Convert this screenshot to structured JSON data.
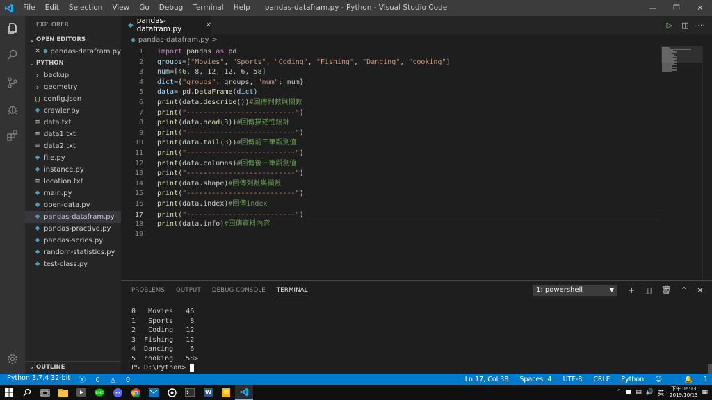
{
  "window": {
    "title": "pandas-datafram.py - Python - Visual Studio Code",
    "menu": [
      "File",
      "Edit",
      "Selection",
      "View",
      "Go",
      "Debug",
      "Terminal",
      "Help"
    ]
  },
  "sidebar": {
    "header": "EXPLORER",
    "open_editors_label": "OPEN EDITORS",
    "open_editors": [
      {
        "name": "pandas-datafram.py"
      }
    ],
    "folder_label": "PYTHON",
    "items": [
      {
        "name": "backup",
        "type": "folder"
      },
      {
        "name": "geometry",
        "type": "folder"
      },
      {
        "name": "config.json",
        "type": "json"
      },
      {
        "name": "crawler.py",
        "type": "py"
      },
      {
        "name": "data.txt",
        "type": "txt"
      },
      {
        "name": "data1.txt",
        "type": "txt"
      },
      {
        "name": "data2.txt",
        "type": "txt"
      },
      {
        "name": "file.py",
        "type": "py"
      },
      {
        "name": "instance.py",
        "type": "py"
      },
      {
        "name": "location.txt",
        "type": "txt"
      },
      {
        "name": "main.py",
        "type": "py"
      },
      {
        "name": "open-data.py",
        "type": "py"
      },
      {
        "name": "pandas-datafram.py",
        "type": "py",
        "selected": true
      },
      {
        "name": "pandas-practive.py",
        "type": "py"
      },
      {
        "name": "pandas-series.py",
        "type": "py"
      },
      {
        "name": "random-statistics.py",
        "type": "py"
      },
      {
        "name": "test-class.py",
        "type": "py"
      }
    ],
    "outline_label": "OUTLINE"
  },
  "editor": {
    "tab_label": "pandas-datafram.py",
    "breadcrumb": "pandas-datafram.py",
    "breadcrumb_sep": ">",
    "current_line": 17,
    "lines": [
      [
        [
          "kw",
          "import"
        ],
        [
          "df",
          " pandas "
        ],
        [
          "kw",
          "as"
        ],
        [
          "df",
          " pd"
        ]
      ],
      [
        [
          "va",
          "groups"
        ],
        [
          "df",
          "=["
        ],
        [
          "st",
          "\"Movies\""
        ],
        [
          "df",
          ", "
        ],
        [
          "st",
          "\"Sports\""
        ],
        [
          "df",
          ", "
        ],
        [
          "st",
          "\"Coding\""
        ],
        [
          "df",
          ", "
        ],
        [
          "st",
          "\"Fishing\""
        ],
        [
          "df",
          ", "
        ],
        [
          "st",
          "\"Dancing\""
        ],
        [
          "df",
          ", "
        ],
        [
          "st",
          "\"cooking\""
        ],
        [
          "df",
          "]"
        ]
      ],
      [
        [
          "va",
          "num"
        ],
        [
          "df",
          "=["
        ],
        [
          "nm",
          "46"
        ],
        [
          "df",
          ", "
        ],
        [
          "nm",
          "8"
        ],
        [
          "df",
          ", "
        ],
        [
          "nm",
          "12"
        ],
        [
          "df",
          ", "
        ],
        [
          "nm",
          "12"
        ],
        [
          "df",
          ", "
        ],
        [
          "nm",
          "6"
        ],
        [
          "df",
          ", "
        ],
        [
          "nm",
          "58"
        ],
        [
          "df",
          "]"
        ]
      ],
      [
        [
          "va",
          "dict"
        ],
        [
          "df",
          "={"
        ],
        [
          "st",
          "\"groups\""
        ],
        [
          "df",
          ": groups, "
        ],
        [
          "st",
          "\"num\""
        ],
        [
          "df",
          ": num}"
        ]
      ],
      [
        [
          "va",
          "data"
        ],
        [
          "df",
          "= pd."
        ],
        [
          "fn",
          "DataFrame"
        ],
        [
          "df",
          "("
        ],
        [
          "va",
          "dict"
        ],
        [
          "df",
          ")"
        ]
      ],
      [
        [
          "fn",
          "print"
        ],
        [
          "df",
          "(data."
        ],
        [
          "fn",
          "describe"
        ],
        [
          "df",
          "())"
        ],
        [
          "cm",
          "#回傳列數與欄數"
        ]
      ],
      [
        [
          "fn",
          "print"
        ],
        [
          "df",
          "("
        ],
        [
          "st",
          "\"--------------------------\""
        ],
        [
          "df",
          ")"
        ]
      ],
      [
        [
          "fn",
          "print"
        ],
        [
          "df",
          "(data."
        ],
        [
          "fn",
          "head"
        ],
        [
          "df",
          "("
        ],
        [
          "nm",
          "3"
        ],
        [
          "df",
          "))"
        ],
        [
          "cm",
          "#回傳描述性統計"
        ]
      ],
      [
        [
          "fn",
          "print"
        ],
        [
          "df",
          "("
        ],
        [
          "st",
          "\"--------------------------\""
        ],
        [
          "df",
          ")"
        ]
      ],
      [
        [
          "fn",
          "print"
        ],
        [
          "df",
          "(data."
        ],
        [
          "fn",
          "tail"
        ],
        [
          "df",
          "("
        ],
        [
          "nm",
          "3"
        ],
        [
          "df",
          "))"
        ],
        [
          "cm",
          "#回傳前三筆觀測值"
        ]
      ],
      [
        [
          "fn",
          "print"
        ],
        [
          "df",
          "("
        ],
        [
          "st",
          "\"--------------------------\""
        ],
        [
          "df",
          ")"
        ]
      ],
      [
        [
          "fn",
          "print"
        ],
        [
          "df",
          "(data.columns)"
        ],
        [
          "cm",
          "#回傳後三筆觀測值"
        ]
      ],
      [
        [
          "fn",
          "print"
        ],
        [
          "df",
          "("
        ],
        [
          "st",
          "\"--------------------------\""
        ],
        [
          "df",
          ")"
        ]
      ],
      [
        [
          "fn",
          "print"
        ],
        [
          "df",
          "(data.shape)"
        ],
        [
          "cm",
          "#回傳列數與欄數"
        ]
      ],
      [
        [
          "fn",
          "print"
        ],
        [
          "df",
          "("
        ],
        [
          "st",
          "\"--------------------------\""
        ],
        [
          "df",
          ")"
        ]
      ],
      [
        [
          "fn",
          "print"
        ],
        [
          "df",
          "(data.index)"
        ],
        [
          "cm",
          "#回傳index"
        ]
      ],
      [
        [
          "fn",
          "print"
        ],
        [
          "df",
          "("
        ],
        [
          "st",
          "\"--------------------------\""
        ],
        [
          "df",
          ")"
        ]
      ],
      [
        [
          "fn",
          "print"
        ],
        [
          "df",
          "(data.info)"
        ],
        [
          "cm",
          "#回傳資料內容"
        ]
      ],
      []
    ]
  },
  "panel": {
    "tabs": [
      "PROBLEMS",
      "OUTPUT",
      "DEBUG CONSOLE",
      "TERMINAL"
    ],
    "active_tab": "TERMINAL",
    "terminal_select": "1: powershell",
    "terminal_lines": [
      "0   Movies   46",
      "1   Sports    8",
      "2   Coding   12",
      "3  Fishing   12",
      "4  Dancing    6",
      "5  cooking   58>"
    ],
    "prompt": "PS D:\\Python> "
  },
  "status": {
    "interpreter": "Python 3.7.4 32-bit",
    "errors": "0",
    "warnings": "0",
    "position": "Ln 17, Col 38",
    "spaces": "Spaces: 4",
    "encoding": "UTF-8",
    "eol": "CRLF",
    "language": "Python",
    "notifications": "1"
  },
  "taskbar": {
    "time": "下午 06:13",
    "date": "2019/10/13",
    "ime": "英"
  },
  "colors": {
    "accent": "#007acc",
    "keyword": "#c586c0",
    "function": "#dcdcaa",
    "string": "#ce9178",
    "number": "#b5cea8",
    "variable": "#9cdcfe",
    "comment": "#6a9955"
  }
}
